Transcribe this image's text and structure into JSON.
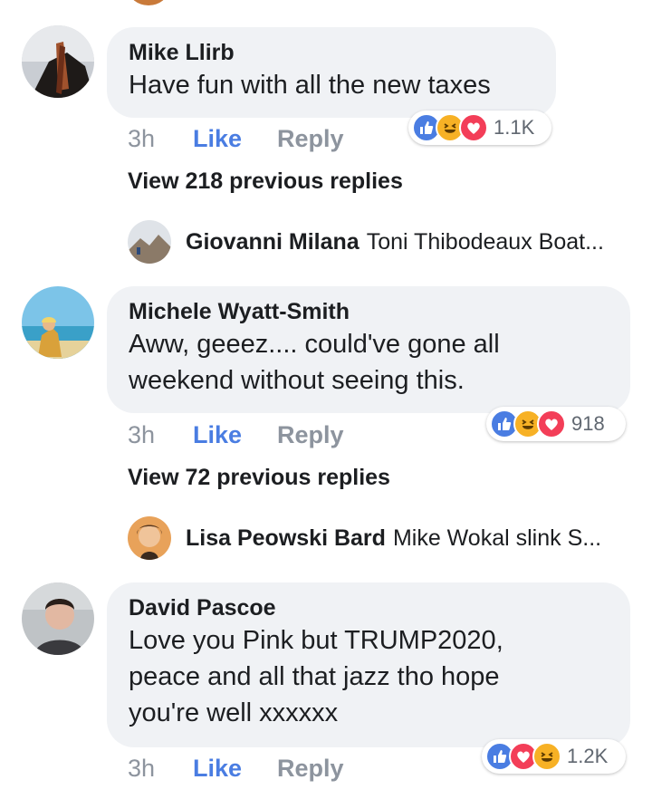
{
  "comments": [
    {
      "author": "Mike Llirb",
      "lines": [
        "Have fun with all the new taxes"
      ],
      "time": "3h",
      "like_label": "Like",
      "reply_label": "Reply",
      "reaction_count": "1.1K",
      "reaction_icons": [
        "like-icon",
        "haha-icon",
        "love-icon"
      ],
      "view_replies": "View 218 previous replies",
      "preview": {
        "name": "Giovanni Milana",
        "snippet": "Toni Thibodeaux Boat..."
      }
    },
    {
      "author": "Michele Wyatt-Smith",
      "lines": [
        "Aww, geeez.... could've gone all",
        "weekend without seeing this."
      ],
      "time": "3h",
      "like_label": "Like",
      "reply_label": "Reply",
      "reaction_count": "918",
      "reaction_icons": [
        "like-icon",
        "haha-icon",
        "love-icon"
      ],
      "view_replies": "View 72 previous replies",
      "preview": {
        "name": "Lisa Peowski Bard",
        "snippet": "Mike Wokal  slink S..."
      }
    },
    {
      "author": "David Pascoe",
      "lines": [
        "Love you Pink but TRUMP2020,",
        "peace and all that jazz tho hope",
        "you're well xxxxxx"
      ],
      "time": "3h",
      "like_label": "Like",
      "reply_label": "Reply",
      "reaction_count": "1.2K",
      "reaction_icons": [
        "like-icon",
        "love-icon",
        "haha-icon"
      ]
    }
  ],
  "colors": {
    "bubble": "#f0f2f5",
    "like_blue": "#4a7de2",
    "muted": "#8d949e",
    "love_red": "#f33e58",
    "haha_yellow": "#f7b125"
  }
}
